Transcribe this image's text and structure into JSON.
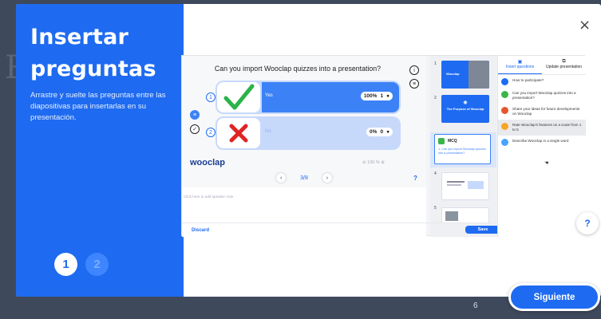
{
  "backdrop": {
    "letter": "R",
    "page_number": "6"
  },
  "sidebar": {
    "title_line1": "Insertar",
    "title_line2": "preguntas",
    "description": "Arrastre y suelte las preguntas entre las diapositivas para insertarlas en su presentación.",
    "steps": [
      "1",
      "2"
    ],
    "active_step": 1
  },
  "close_icon": "×",
  "editor": {
    "question": "Can you import Wooclap quizzes into a presentation?",
    "answers": [
      {
        "number": "1",
        "label": "Yes",
        "percent": "100%",
        "count": "1",
        "fill": 1.0,
        "correct": true
      },
      {
        "number": "2",
        "label": "No",
        "percent": "0%",
        "count": "0",
        "fill": 0.0,
        "correct": false
      }
    ],
    "brand": "wooclap",
    "zoom": "100 %",
    "page": "3/8",
    "help": "?",
    "notes_placeholder": "Click here to add speaker note",
    "discard": "Discard",
    "save": "Save"
  },
  "thumbnails": [
    {
      "number": "1",
      "title": "Wooclap"
    },
    {
      "number": "2",
      "title": "The Purpose of Wooclap"
    },
    {
      "number": "3",
      "tag": "MCQ",
      "text": "1. Can you import Wooclap quizzes into a presentation?"
    },
    {
      "number": "4"
    },
    {
      "number": "5"
    }
  ],
  "panel": {
    "tabs": [
      "Insert questions",
      "Update presentation"
    ],
    "questions": [
      {
        "text": "How to participate?",
        "color": "#1e6bf1"
      },
      {
        "text": "Can you import Wooclap quizzes into a presentation?",
        "color": "#3ab54a"
      },
      {
        "text": "Share your ideas for future developments on Wooclap",
        "color": "#e4572e"
      },
      {
        "text": "Rate Wooclap's features on a scale from 1 to 5",
        "color": "#f5a623"
      },
      {
        "text": "Describe Wooclap in a single word",
        "color": "#4aa3ff"
      }
    ],
    "help": "?"
  },
  "help_button": "?",
  "next_button": "Siguiente",
  "colors": {
    "primary": "#1e6bf1",
    "correct": "#2bb34a",
    "wrong": "#e02424"
  }
}
